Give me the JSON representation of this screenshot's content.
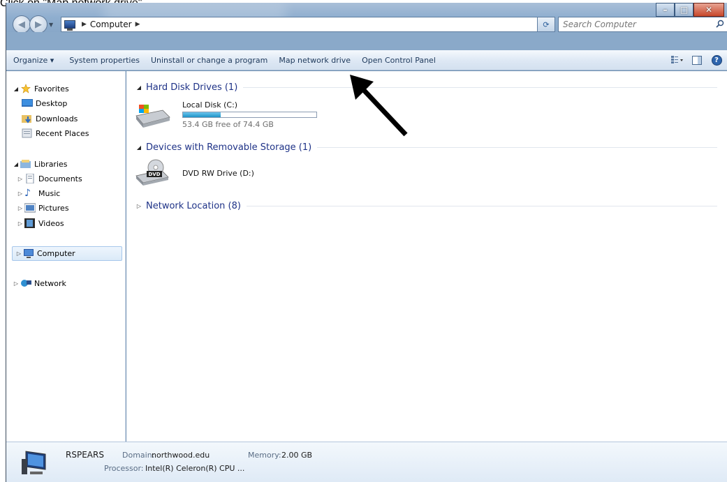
{
  "caption": "Click on \"Map network drive\"",
  "window": {
    "minimize_icon": "minimize-icon",
    "maximize_icon": "maximize-icon",
    "close_icon": "close-icon"
  },
  "address": {
    "path": [
      "Computer"
    ]
  },
  "search": {
    "placeholder": "Search Computer"
  },
  "toolbar": {
    "organize": "Organize ▾",
    "system_properties": "System properties",
    "uninstall": "Uninstall or change a program",
    "map_network_drive": "Map network drive",
    "open_control_panel": "Open Control Panel"
  },
  "nav": {
    "favorites": "Favorites",
    "desktop": "Desktop",
    "downloads": "Downloads",
    "recent_places": "Recent Places",
    "libraries": "Libraries",
    "documents": "Documents",
    "music": "Music",
    "pictures": "Pictures",
    "videos": "Videos",
    "computer": "Computer",
    "network": "Network"
  },
  "content": {
    "hard_disk_group": "Hard Disk Drives (1)",
    "local_disk_name": "Local Disk (C:)",
    "local_disk_free": "53.4 GB free of 74.4 GB",
    "local_disk_used_fraction": 0.282,
    "removable_group": "Devices with Removable Storage (1)",
    "dvd_name": "DVD RW Drive (D:)",
    "dvd_label": "DVD",
    "network_group": "Network Location (8)"
  },
  "details": {
    "computer_name": "RSPEARS",
    "domain_label": "Domain:",
    "domain_value": "northwood.edu",
    "memory_label": "Memory:",
    "memory_value": "2.00 GB",
    "processor_label": "Processor:",
    "processor_value": "Intel(R) Celeron(R) CPU ..."
  },
  "colors": {
    "accent": "#1e3287",
    "drive_bar": "#1e93c7",
    "arrow": "#000000"
  }
}
